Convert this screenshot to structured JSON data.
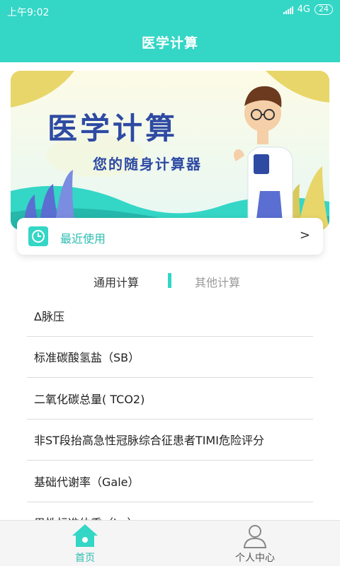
{
  "status": {
    "time": "上午9:02",
    "network": "4G",
    "battery": "24"
  },
  "header": {
    "title": "医学计算"
  },
  "banner": {
    "title": "医学计算",
    "subtitle": "您的随身计算器"
  },
  "recent": {
    "label": "最近使用",
    "arrow": ">"
  },
  "tabs": [
    {
      "label": "通用计算",
      "active": true
    },
    {
      "label": "其他计算",
      "active": false
    }
  ],
  "list": {
    "items": [
      {
        "label": "Δ脉压"
      },
      {
        "label": "标准碳酸氢盐（SB）"
      },
      {
        "label": "二氧化碳总量( TCO2)"
      },
      {
        "label": "非ST段抬高急性冠脉综合征患者TIMI危险评分"
      },
      {
        "label": "基础代谢率（Gale）"
      },
      {
        "label": "男性标准体重（kg）"
      }
    ]
  },
  "tabbar": {
    "items": [
      {
        "label": "首页",
        "icon": "home-icon",
        "active": true
      },
      {
        "label": "个人中心",
        "icon": "user-icon",
        "active": false
      }
    ]
  },
  "colors": {
    "accent": "#34d6c6",
    "accent_text": "#2bbdb0",
    "banner_text": "#2e4aa3"
  }
}
